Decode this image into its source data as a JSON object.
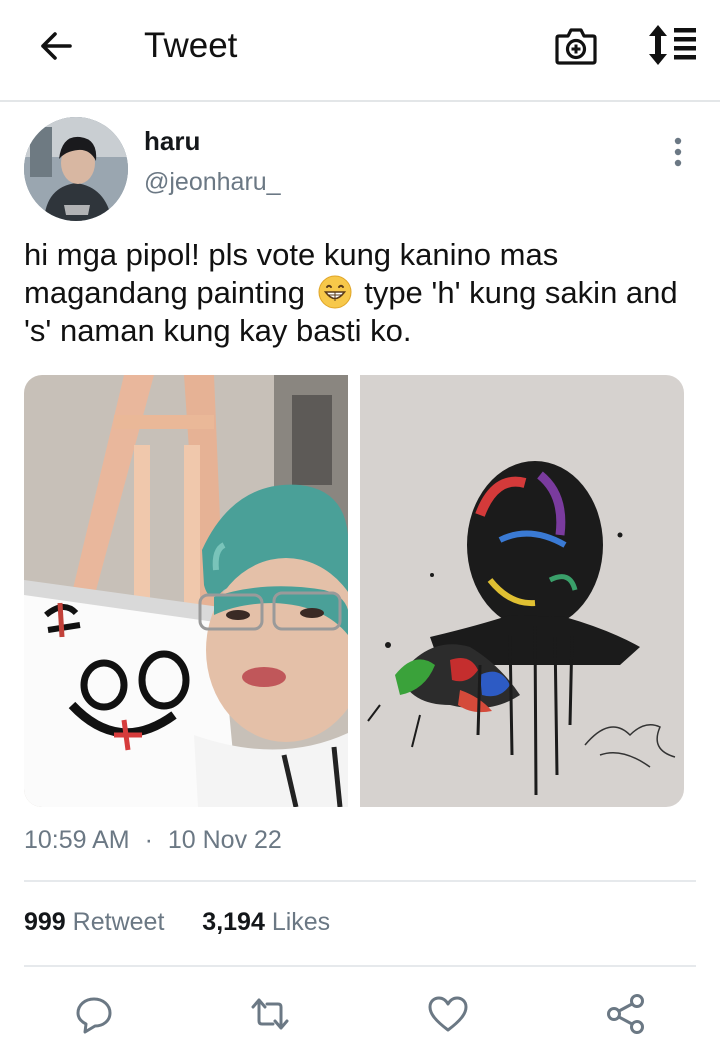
{
  "header": {
    "title": "Tweet",
    "icons": [
      "back-arrow-icon",
      "camera-icon",
      "sort-icon"
    ]
  },
  "tweet": {
    "author": {
      "name": "haru",
      "handle": "@jeonharu_"
    },
    "text_part1": "hi mga pipol! pls vote kung kanino mas magandang painting",
    "emoji": "grinning-face-icon",
    "text_part2": "type 'h' kung sakin and 's' naman kung kay basti ko.",
    "media": [
      {
        "description": "person-holding-painting"
      },
      {
        "description": "abstract-portrait-painting"
      }
    ],
    "time": "10:59 AM",
    "separator": "·",
    "date": "10 Nov 22",
    "retweets_count": "999",
    "retweets_label": "Retweet",
    "likes_count": "3,194",
    "likes_label": "Likes"
  },
  "actions": [
    "reply-icon",
    "retweet-icon",
    "like-icon",
    "share-icon"
  ],
  "colors": {
    "text": "#14171a",
    "secondary": "#6b7884",
    "divider": "#e6e9ec"
  }
}
